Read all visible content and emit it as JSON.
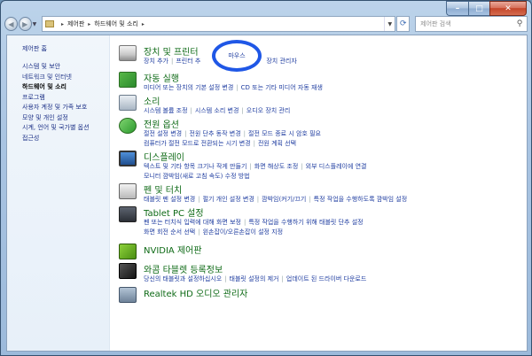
{
  "window": {
    "caption_min": "–",
    "caption_max": "□",
    "caption_close": "✕"
  },
  "address": {
    "crumbs": [
      "제어판",
      "하드웨어 및 소리"
    ],
    "search_placeholder": "제어판 검색"
  },
  "sidebar": {
    "home": "제어판 홈",
    "items": [
      {
        "label": "시스템 및 보안",
        "active": false
      },
      {
        "label": "네트워크 및 인터넷",
        "active": false
      },
      {
        "label": "하드웨어 및 소리",
        "active": true
      },
      {
        "label": "프로그램",
        "active": false
      },
      {
        "label": "사용자 계정 및 가족 보호",
        "active": false
      },
      {
        "label": "모양 및 개인 설정",
        "active": false
      },
      {
        "label": "시계, 언어 및 국가별 옵션",
        "active": false
      },
      {
        "label": "접근성",
        "active": false
      }
    ]
  },
  "categories": [
    {
      "title": "장치 및 프린터",
      "links": [
        "장치 추가",
        "프린터 추",
        "",
        "장치 관리자"
      ]
    },
    {
      "title": "자동 실행",
      "links": [
        "미디어 또는 장치의 기본 설정 변경",
        "CD 또는 기타 미디어 자동 재생"
      ]
    },
    {
      "title": "소리",
      "links": [
        "시스템 볼륨 조정",
        "시스템 소리 변경",
        "오디오 장치 관리"
      ]
    },
    {
      "title": "전원 옵션",
      "links": [
        "절전 설정 변경",
        "전원 단추 동작 변경",
        "절전 모드 종료 시 암호 필요",
        "컴퓨터가 절전 모드로 전환되는 시기 변경",
        "전원 계획 선택"
      ]
    },
    {
      "title": "디스플레이",
      "links": [
        "텍스트 및 기타 항목 크기나 작게 만들기",
        "화면 해상도 조정",
        "외부 디스플레이에 연결",
        "모니터 깜박임(새로 고침 속도) 수정 방법"
      ]
    },
    {
      "title": "펜 및 터치",
      "links": [
        "태블릿 펜 설정 변경",
        "펄기 개인 설정 변경",
        "깜박임(커기/끄기",
        "특정 작업을 수행하도록 깜박임 설정"
      ]
    },
    {
      "title": "Tablet PC 설정",
      "links": [
        "펜 또는 터치식 입력에 대해 화면 보정",
        "특정 작업을 수행하기 위해 태블릿 단추 설정",
        "화면 회전 순서 선택",
        "왼손잡이/오른손잡이 설정 지정"
      ]
    },
    {
      "title": "NVIDIA 제어판",
      "links": []
    },
    {
      "title": "와콤 타블렛 등록정보",
      "links": [
        "당신의 태블릿과 설정하십시오",
        "태블릿 설정의 제거",
        "업데이트 된 드라이버 다운로드"
      ]
    },
    {
      "title": "Realtek HD 오디오 관리자",
      "links": []
    }
  ],
  "highlight": {
    "label": "마우스",
    "color": "#1f57e6"
  }
}
